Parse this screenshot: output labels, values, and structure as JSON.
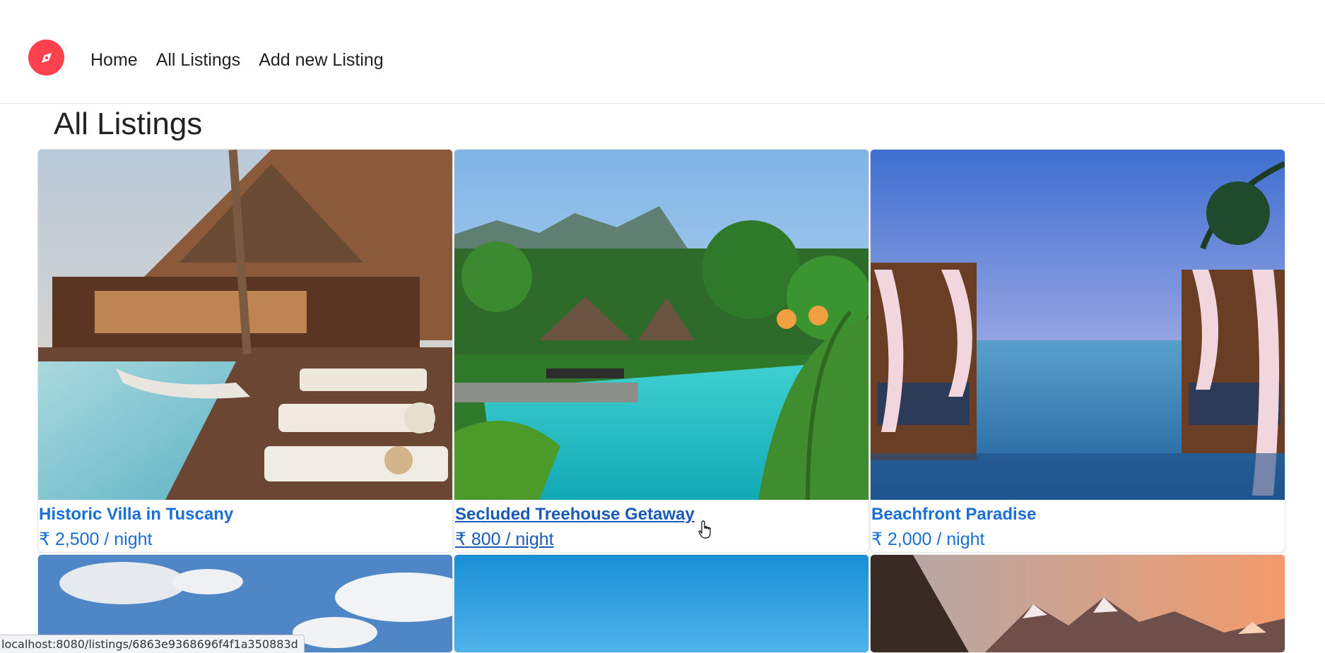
{
  "nav": {
    "brand_icon": "compass-icon",
    "brand_color": "#fe424d",
    "links": [
      "Home",
      "All Listings",
      "Add new Listing"
    ]
  },
  "page_title": "All Listings",
  "listings": [
    {
      "title": "Historic Villa in Tuscany",
      "price": "₹ 2,500 / night",
      "image": "resort-pool-with-wooden-lodge-photo"
    },
    {
      "title": "Secluded Treehouse Getaway",
      "price": "₹ 800 / night",
      "image": "tropical-pool-with-thatched-huts-photo",
      "hovered": true
    },
    {
      "title": "Beachfront Paradise",
      "price": "₹ 2,000 / night",
      "image": "infinity-pool-with-cabanas-at-dusk-photo"
    },
    {
      "image": "clouds-over-blue-sky-photo"
    },
    {
      "image": "clear-blue-sky-photo"
    },
    {
      "image": "mountain-peaks-at-sunset-photo"
    }
  ],
  "status_url": "localhost:8080/listings/6863e9368696f4f1a350883d",
  "colors": {
    "link": "#1a6fd6",
    "accent": "#fe424d"
  }
}
